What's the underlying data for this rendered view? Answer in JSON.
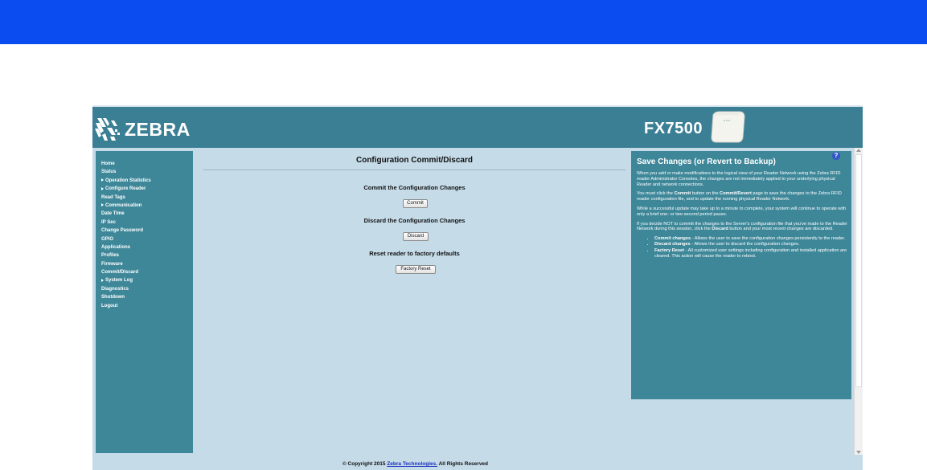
{
  "colors": {
    "topbar": "#0a4cf0",
    "header": "#3b7f95",
    "panel": "#3d8799",
    "background": "#c5dbe8"
  },
  "header": {
    "brand": "ZEBRA",
    "model": "FX7500",
    "logo_icon": "zebra-logo-icon",
    "device_icon": "reader-device-icon"
  },
  "sidebar": {
    "items": [
      {
        "label": "Home",
        "expandable": false
      },
      {
        "label": "Status",
        "expandable": false
      },
      {
        "label": "Operation Statistics",
        "expandable": true
      },
      {
        "label": "Configure Reader",
        "expandable": true
      },
      {
        "label": "Read Tags",
        "expandable": false
      },
      {
        "label": "Communication",
        "expandable": true
      },
      {
        "label": "Date Time",
        "expandable": false
      },
      {
        "label": "IP Sec",
        "expandable": false
      },
      {
        "label": "Change Password",
        "expandable": false
      },
      {
        "label": "GPIO",
        "expandable": false
      },
      {
        "label": "Applications",
        "expandable": false
      },
      {
        "label": "Profiles",
        "expandable": false
      },
      {
        "label": "Firmware",
        "expandable": false
      },
      {
        "label": "Commit/Discard",
        "expandable": false
      },
      {
        "label": "System Log",
        "expandable": true
      },
      {
        "label": "Diagnostics",
        "expandable": false
      },
      {
        "label": "Shutdown",
        "expandable": false
      },
      {
        "label": "Logout",
        "expandable": false
      }
    ]
  },
  "main": {
    "title": "Configuration Commit/Discard",
    "commit": {
      "heading": "Commit the Configuration Changes",
      "button": "Commit"
    },
    "discard": {
      "heading": "Discard the Configuration Changes",
      "button": "Discard"
    },
    "reset": {
      "heading": "Reset reader to factory defaults",
      "button": "Factory Reset"
    }
  },
  "help": {
    "title": "Save Changes (or Revert to Backup)",
    "help_icon": "?",
    "p1": "When you add or make modifications to the logical view of your Reader Network using the Zebra RFID reader Administrator Consoles, the changes are not immediately applied to your underlying physical Reader and network connections.",
    "p2_pre": "You must click the ",
    "p2_commit": "Commit",
    "p2_mid": " button on the ",
    "p2_page": "Commit/Revert",
    "p2_post": " page to save the changes to the Zebra RFID reader configuration file, and to update the running physical Reader Network.",
    "p3": "While a successful update may take up to a minute to complete, your system will continue to operate with only a brief one- or two-second period pause.",
    "p4_pre": "If you decide NOT to commit the changes to the Server's configuration file that you've made to the Reader Network during this session, click the ",
    "p4_discard": "Discard",
    "p4_post": " button and your most recent changes are discarded.",
    "bullets": [
      {
        "term": "Commit changes",
        "text": " - Allows the user to save the configuration changes persistently to the reader."
      },
      {
        "term": "Discard changes",
        "text": " - Allows the user to discard the configuration changes."
      },
      {
        "term": "Factory Reset",
        "text": " - All customized user settings including configuration and installed application are cleared. This action will cause the reader to reboot."
      }
    ]
  },
  "footer": {
    "prefix": "© Copyright 2015 ",
    "link": "Zebra Technologies.",
    "suffix": " All Rights Reserved"
  }
}
